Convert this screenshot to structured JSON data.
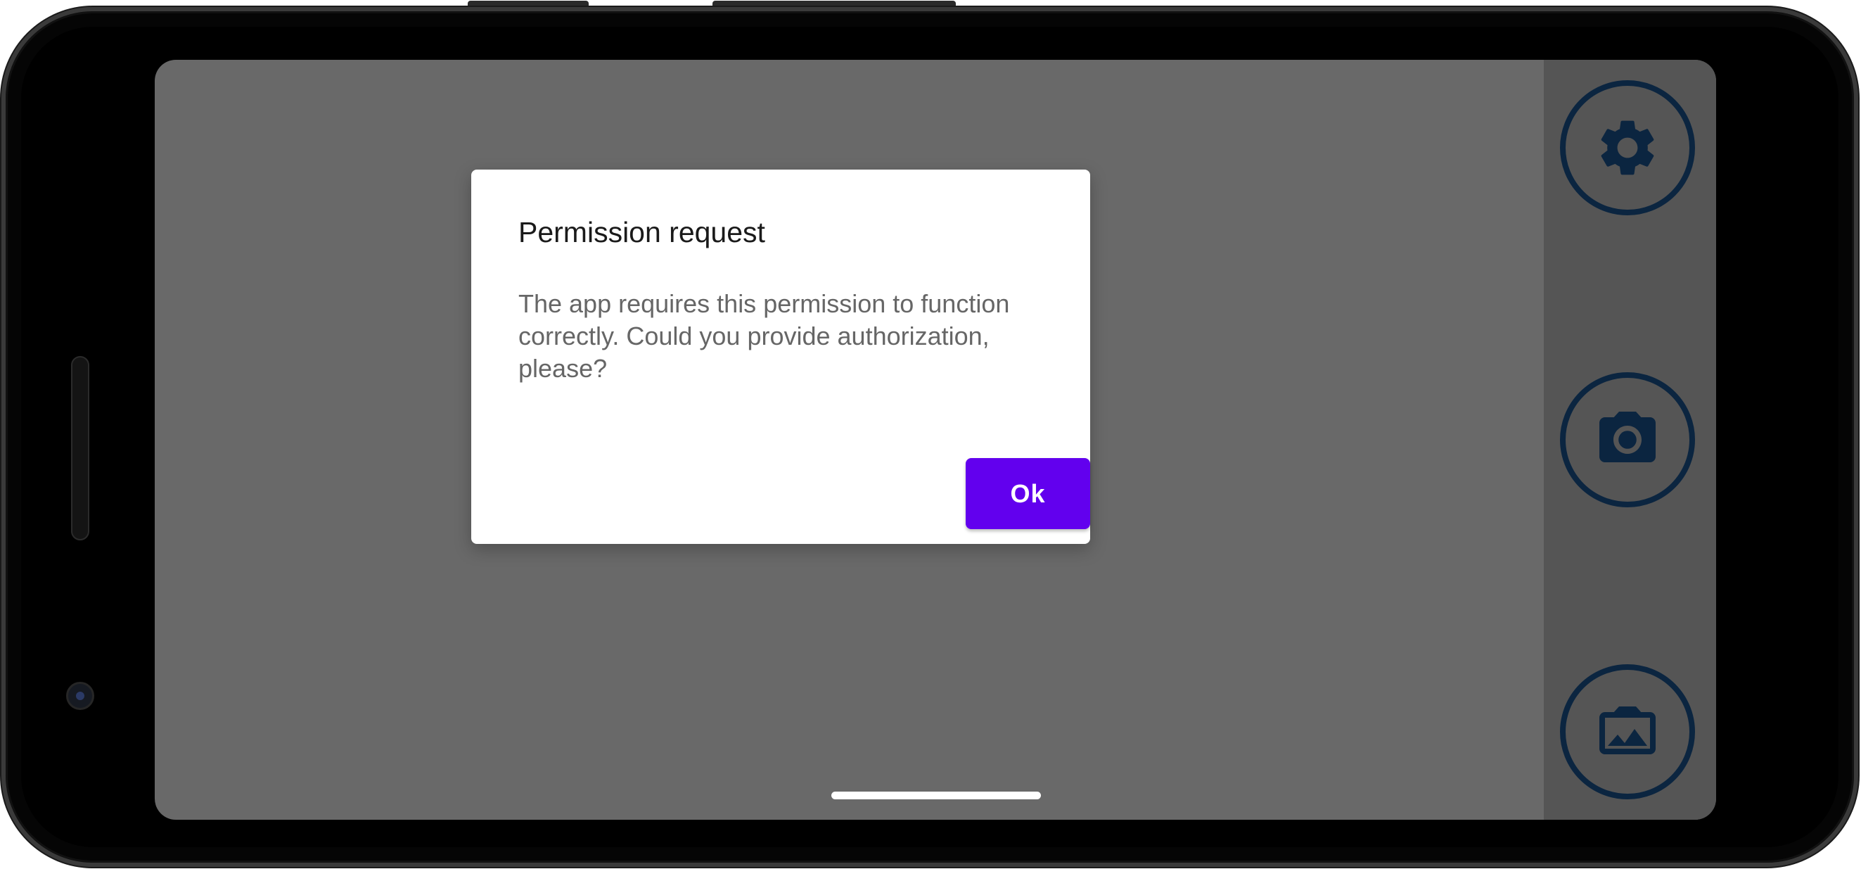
{
  "dialog": {
    "title": "Permission request",
    "message": "The app requires this permission to function correctly. Could you provide authorization, please?",
    "ok_label": "Ok"
  },
  "side_controls": {
    "settings_icon": "gear-icon",
    "camera_icon": "camera-icon",
    "gallery_icon": "gallery-icon"
  },
  "colors": {
    "accent": "#6200ee",
    "icon": "#0b2540",
    "screen_dim": "#696969"
  }
}
